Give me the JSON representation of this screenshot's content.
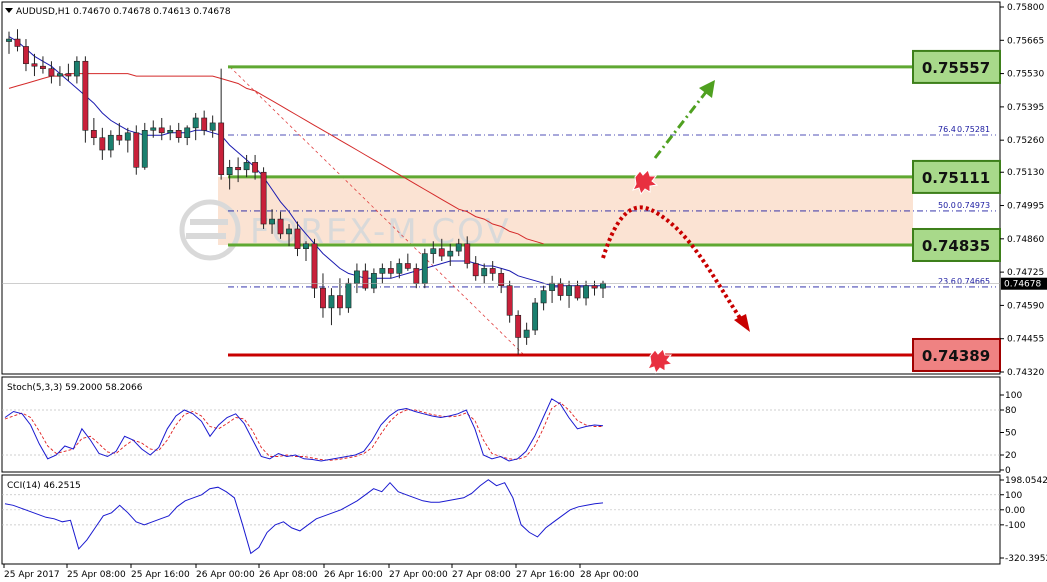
{
  "chart_data": [
    {
      "type": "candlestick",
      "symbol_header": "AUDUSD,H1  0.74670 0.74678 0.74613 0.74678",
      "ylim": [
        0.7432,
        0.758
      ],
      "y_ticks": [
        "0.75800",
        "0.75665",
        "0.75530",
        "0.75395",
        "0.75260",
        "0.75130",
        "0.74995",
        "0.74860",
        "0.74725",
        "0.74590",
        "0.74455",
        "0.74320"
      ],
      "y_tick_values": [
        0.758,
        0.75665,
        0.7553,
        0.75395,
        0.7526,
        0.7513,
        0.74995,
        0.7486,
        0.74725,
        0.7459,
        0.74455,
        0.7432
      ],
      "x_labels": [
        "25 Apr 2017",
        "25 Apr 08:00",
        "25 Apr 16:00",
        "26 Apr 00:00",
        "26 Apr 08:00",
        "26 Apr 16:00",
        "27 Apr 00:00",
        "27 Apr 08:00",
        "27 Apr 16:00",
        "28 Apr 00:00"
      ],
      "current_price": "0.74678",
      "current_price_value": 0.74678,
      "candles": [
        [
          0.7566,
          0.757,
          0.7561,
          0.7567
        ],
        [
          0.7567,
          0.7571,
          0.7562,
          0.7564
        ],
        [
          0.7564,
          0.7567,
          0.7554,
          0.7557
        ],
        [
          0.7557,
          0.7561,
          0.7552,
          0.7556
        ],
        [
          0.7556,
          0.756,
          0.7553,
          0.7555
        ],
        [
          0.7555,
          0.7558,
          0.7549,
          0.7552
        ],
        [
          0.7552,
          0.7556,
          0.7548,
          0.7553
        ],
        [
          0.7553,
          0.7557,
          0.755,
          0.7552
        ],
        [
          0.7552,
          0.756,
          0.7549,
          0.7558
        ],
        [
          0.7558,
          0.756,
          0.7525,
          0.753
        ],
        [
          0.753,
          0.7535,
          0.7524,
          0.7527
        ],
        [
          0.7527,
          0.7531,
          0.7518,
          0.7522
        ],
        [
          0.7522,
          0.753,
          0.7519,
          0.7528
        ],
        [
          0.7528,
          0.7533,
          0.7524,
          0.7526
        ],
        [
          0.7526,
          0.7531,
          0.7521,
          0.7529
        ],
        [
          0.7529,
          0.7532,
          0.7512,
          0.7515
        ],
        [
          0.7515,
          0.7533,
          0.7514,
          0.753
        ],
        [
          0.753,
          0.7534,
          0.7527,
          0.7531
        ],
        [
          0.7531,
          0.7535,
          0.7526,
          0.7529
        ],
        [
          0.7529,
          0.7532,
          0.7526,
          0.753
        ],
        [
          0.753,
          0.7533,
          0.7525,
          0.7527
        ],
        [
          0.7527,
          0.7532,
          0.7524,
          0.7531
        ],
        [
          0.7531,
          0.7537,
          0.7526,
          0.7535
        ],
        [
          0.7535,
          0.7538,
          0.7528,
          0.753
        ],
        [
          0.753,
          0.7536,
          0.7527,
          0.7533
        ],
        [
          0.7533,
          0.7555,
          0.751,
          0.7512
        ],
        [
          0.7512,
          0.7518,
          0.7506,
          0.7515
        ],
        [
          0.7515,
          0.7519,
          0.7509,
          0.7514
        ],
        [
          0.7514,
          0.752,
          0.7511,
          0.7517
        ],
        [
          0.7517,
          0.752,
          0.751,
          0.7513
        ],
        [
          0.7513,
          0.7515,
          0.749,
          0.7492
        ],
        [
          0.7492,
          0.7498,
          0.7488,
          0.7494
        ],
        [
          0.7494,
          0.7497,
          0.7486,
          0.7488
        ],
        [
          0.7488,
          0.7492,
          0.7483,
          0.749
        ],
        [
          0.749,
          0.7493,
          0.7479,
          0.7482
        ],
        [
          0.7482,
          0.7485,
          0.7477,
          0.7484
        ],
        [
          0.7484,
          0.7486,
          0.7462,
          0.7466
        ],
        [
          0.7466,
          0.7472,
          0.7454,
          0.7458
        ],
        [
          0.7458,
          0.7466,
          0.7451,
          0.7463
        ],
        [
          0.7463,
          0.747,
          0.7455,
          0.7458
        ],
        [
          0.7458,
          0.747,
          0.7456,
          0.7468
        ],
        [
          0.7468,
          0.7476,
          0.7464,
          0.7473
        ],
        [
          0.7473,
          0.7476,
          0.7465,
          0.7466
        ],
        [
          0.7466,
          0.7474,
          0.7464,
          0.7472
        ],
        [
          0.7472,
          0.7476,
          0.7468,
          0.7474
        ],
        [
          0.7474,
          0.7477,
          0.747,
          0.7472
        ],
        [
          0.7472,
          0.7478,
          0.747,
          0.7476
        ],
        [
          0.7476,
          0.748,
          0.7473,
          0.7474
        ],
        [
          0.7474,
          0.7476,
          0.7466,
          0.7468
        ],
        [
          0.7468,
          0.7482,
          0.7466,
          0.748
        ],
        [
          0.748,
          0.7485,
          0.7476,
          0.7482
        ],
        [
          0.7482,
          0.7486,
          0.7477,
          0.7479
        ],
        [
          0.7479,
          0.7484,
          0.7475,
          0.7481
        ],
        [
          0.7481,
          0.7486,
          0.7479,
          0.7484
        ],
        [
          0.7484,
          0.7487,
          0.7474,
          0.7476
        ],
        [
          0.7476,
          0.7479,
          0.7469,
          0.7471
        ],
        [
          0.7471,
          0.7476,
          0.7468,
          0.7474
        ],
        [
          0.7474,
          0.7477,
          0.7469,
          0.7472
        ],
        [
          0.7472,
          0.7474,
          0.7464,
          0.7467
        ],
        [
          0.7467,
          0.7469,
          0.7452,
          0.7455
        ],
        [
          0.7455,
          0.7457,
          0.7439,
          0.7446
        ],
        [
          0.7446,
          0.7452,
          0.7443,
          0.7449
        ],
        [
          0.7449,
          0.7462,
          0.7447,
          0.746
        ],
        [
          0.746,
          0.7467,
          0.7457,
          0.7465
        ],
        [
          0.7465,
          0.7471,
          0.746,
          0.7468
        ],
        [
          0.7468,
          0.747,
          0.7461,
          0.7463
        ],
        [
          0.7463,
          0.7469,
          0.7458,
          0.7467
        ],
        [
          0.7467,
          0.7469,
          0.7461,
          0.7462
        ],
        [
          0.7462,
          0.7469,
          0.7459,
          0.7467
        ],
        [
          0.7467,
          0.7469,
          0.7463,
          0.7466
        ],
        [
          0.7466,
          0.7469,
          0.7462,
          0.7468
        ]
      ],
      "ma_fast": [
        0.7568,
        0.7566,
        0.7563,
        0.756,
        0.7558,
        0.7556,
        0.7553,
        0.755,
        0.7547,
        0.7544,
        0.7541,
        0.7537,
        0.7534,
        0.7532,
        0.753,
        0.7529,
        0.7528,
        0.7528,
        0.7528,
        0.7529,
        0.7529,
        0.7529,
        0.753,
        0.753,
        0.7529,
        0.7528,
        0.7524,
        0.7521,
        0.7518,
        0.7515,
        0.7511,
        0.7506,
        0.7501,
        0.7497,
        0.7492,
        0.7488,
        0.7484,
        0.748,
        0.7477,
        0.7474,
        0.7472,
        0.7471,
        0.747,
        0.747,
        0.747,
        0.747,
        0.7471,
        0.7472,
        0.7473,
        0.7474,
        0.7475,
        0.7476,
        0.7477,
        0.7477,
        0.7477,
        0.7476,
        0.7475,
        0.7475,
        0.7474,
        0.7473,
        0.7471,
        0.747,
        0.7469,
        0.7468,
        0.7467,
        0.7467,
        0.7467,
        0.7467,
        0.7467,
        0.7467,
        0.7467
      ],
      "ma_slow": [
        0.7547,
        0.7548,
        0.7549,
        0.755,
        0.7551,
        0.7552,
        0.7552,
        0.7553,
        0.7553,
        0.7553,
        0.7553,
        0.7553,
        0.7553,
        0.7553,
        0.7553,
        0.7552,
        0.7552,
        0.7552,
        0.7552,
        0.7552,
        0.7552,
        0.7552,
        0.7552,
        0.7552,
        0.7552,
        0.7551,
        0.755,
        0.7549,
        0.7547,
        0.7546,
        0.7544,
        0.7542,
        0.754,
        0.7538,
        0.7536,
        0.7534,
        0.7532,
        0.753,
        0.7528,
        0.7526,
        0.7524,
        0.7522,
        0.752,
        0.7518,
        0.7516,
        0.7514,
        0.7512,
        0.751,
        0.7508,
        0.7506,
        0.7504,
        0.7502,
        0.75,
        0.7498,
        0.7497,
        0.7495,
        0.7494,
        0.7492,
        0.7491,
        0.7489,
        0.7488,
        0.7486,
        0.7485,
        0.7484
      ],
      "fib_levels": [
        {
          "pct": "76.4",
          "value": "0.75281",
          "price": 0.75281
        },
        {
          "pct": "50.0",
          "value": "0.74973",
          "price": 0.74973
        },
        {
          "pct": "23.6",
          "value": "0.74665",
          "price": 0.74665
        }
      ],
      "fib_line_color": "#1a1aa0",
      "levels": [
        {
          "label": "0.75557",
          "price": 0.75557,
          "color": "#5fa832",
          "box_fill": "#a8d98a"
        },
        {
          "label": "0.75111",
          "price": 0.75111,
          "color": "#5fa832",
          "box_fill": "#a8d98a"
        },
        {
          "label": "0.74835",
          "price": 0.74835,
          "color": "#5fa832",
          "box_fill": "#a8d98a"
        },
        {
          "label": "0.74389",
          "price": 0.74389,
          "color": "#c80000",
          "box_fill": "#ef8282"
        }
      ],
      "zone": {
        "top": 0.75111,
        "bottom": 0.74835,
        "color": "#fbe3d3"
      },
      "watermark": "FOREX-M.COV",
      "colors": {
        "bull": "#1a7f6e",
        "bear": "#c8203a",
        "ma_fast": "#1a1ab0",
        "ma_slow": "#d42a2a",
        "up_arrow": "#4fa020",
        "down_arrow": "#c80000"
      }
    },
    {
      "type": "line",
      "name": "stochastic",
      "header": "Stoch(5,3,3) 59.2000 58.2066",
      "ylim": [
        0,
        100
      ],
      "y_ticks": [
        "100",
        "80",
        "50",
        "20",
        "0"
      ],
      "y_tick_values": [
        100,
        80,
        50,
        20,
        0
      ],
      "main": [
        70,
        78,
        75,
        60,
        35,
        15,
        20,
        32,
        28,
        55,
        40,
        22,
        18,
        25,
        45,
        40,
        28,
        20,
        30,
        55,
        72,
        80,
        75,
        65,
        45,
        60,
        70,
        75,
        62,
        40,
        18,
        15,
        22,
        18,
        20,
        15,
        14,
        12,
        14,
        16,
        18,
        20,
        25,
        40,
        60,
        72,
        80,
        82,
        78,
        75,
        72,
        70,
        72,
        75,
        80,
        55,
        20,
        15,
        18,
        12,
        15,
        25,
        45,
        70,
        95,
        88,
        70,
        55,
        58,
        60,
        59
      ],
      "signal": [
        68,
        72,
        76,
        70,
        52,
        32,
        22,
        25,
        28,
        42,
        45,
        35,
        24,
        22,
        32,
        40,
        36,
        28,
        26,
        40,
        60,
        74,
        78,
        72,
        58,
        55,
        62,
        70,
        68,
        52,
        30,
        18,
        18,
        20,
        18,
        18,
        16,
        14,
        13,
        14,
        16,
        18,
        22,
        30,
        48,
        64,
        75,
        80,
        80,
        77,
        74,
        72,
        71,
        72,
        76,
        66,
        40,
        22,
        18,
        15,
        14,
        18,
        32,
        55,
        82,
        90,
        80,
        66,
        60,
        58,
        58
      ]
    },
    {
      "type": "line",
      "name": "cci",
      "header": "CCI(14) 46.2515",
      "ylim": [
        -320.3952,
        198.0542
      ],
      "y_ticks": [
        "198.0542",
        "100",
        "0.00",
        "-100",
        "-320.3952"
      ],
      "y_tick_values": [
        198.0542,
        100,
        0,
        -100,
        -320.3952
      ],
      "values": [
        40,
        30,
        10,
        -10,
        -30,
        -50,
        -60,
        -80,
        -70,
        -260,
        -200,
        -120,
        -40,
        -20,
        30,
        -20,
        -80,
        -100,
        -80,
        -60,
        -40,
        20,
        60,
        80,
        100,
        140,
        150,
        120,
        80,
        -100,
        -290,
        -250,
        -150,
        -100,
        -80,
        -120,
        -140,
        -100,
        -60,
        -40,
        -20,
        0,
        30,
        60,
        100,
        140,
        120,
        180,
        120,
        100,
        80,
        60,
        50,
        50,
        60,
        70,
        80,
        110,
        160,
        200,
        160,
        180,
        80,
        -100,
        -150,
        -180,
        -120,
        -80,
        -40,
        0,
        20,
        30,
        40,
        46
      ]
    }
  ]
}
